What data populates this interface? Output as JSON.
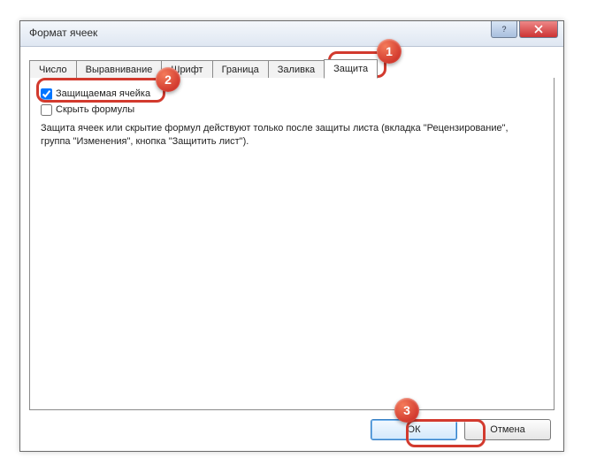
{
  "window": {
    "title": "Формат ячеек"
  },
  "tabs": [
    {
      "label": "Число"
    },
    {
      "label": "Выравнивание"
    },
    {
      "label": "Шрифт"
    },
    {
      "label": "Граница"
    },
    {
      "label": "Заливка"
    },
    {
      "label": "Защита"
    }
  ],
  "content": {
    "protected_cell_label": "Защищаемая ячейка",
    "protected_cell_checked": true,
    "hide_formulas_label": "Скрыть формулы",
    "hide_formulas_checked": false,
    "description": "Защита ячеек или скрытие формул действуют только после защиты листа (вкладка \"Рецензирование\", группа \"Изменения\", кнопка \"Защитить лист\")."
  },
  "buttons": {
    "ok": "ОК",
    "cancel": "Отмена"
  },
  "callouts": {
    "c1": "1",
    "c2": "2",
    "c3": "3"
  },
  "colors": {
    "accent_red": "#d23a2e"
  }
}
